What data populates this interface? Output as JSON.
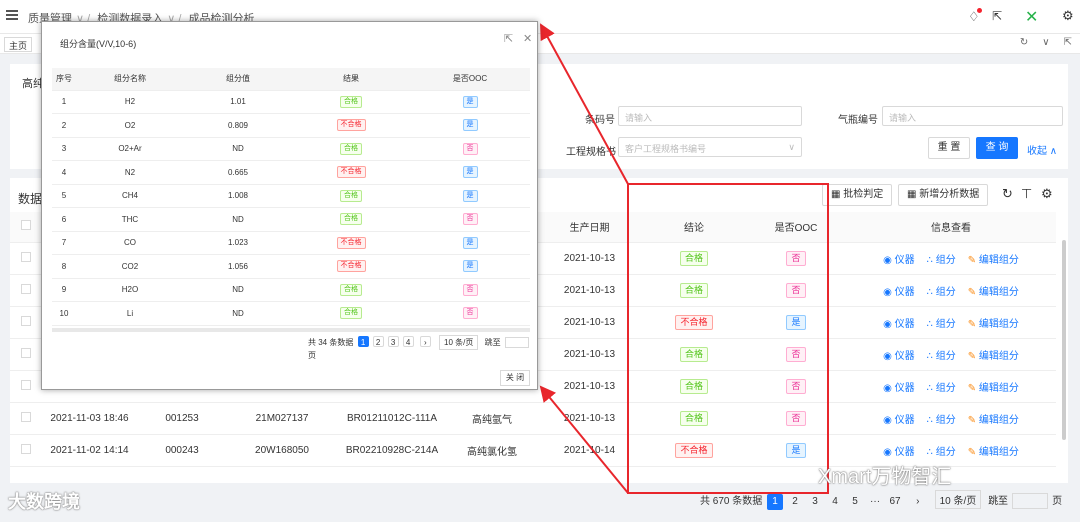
{
  "breadcrumb": [
    "质量管理",
    "检测数据录入",
    "成品检测分析"
  ],
  "tabs": {
    "home": "主页"
  },
  "filter": {
    "title_partial": "高纯",
    "barcode_label": "条码号",
    "barcode_placeholder": "请输入",
    "cylinder_label": "气瓶编号",
    "cylinder_placeholder": "请输入",
    "spec_label": "工程规格书",
    "spec_placeholder": "客户工程规格书编号",
    "reset": "重 置",
    "query": "查 询",
    "collapse": "收起"
  },
  "data_card": {
    "title_partial": "数据",
    "batch_judge": "批检判定",
    "add_analysis": "新增分析数据"
  },
  "main_table": {
    "headers": {
      "date": "生产日期",
      "result": "结论",
      "ooc": "是否OOC",
      "info": "信息查看"
    },
    "actions": {
      "instrument": "仪器",
      "component": "组分",
      "edit": "编辑组分"
    },
    "rows": [
      {
        "time": "",
        "code": "",
        "lot": "",
        "batch": "",
        "gas": "",
        "date": "2021-10-13",
        "result": "合格",
        "rt": "ok",
        "ooc": "否",
        "ot": "no"
      },
      {
        "time": "",
        "code": "",
        "lot": "",
        "batch": "",
        "gas": "",
        "date": "2021-10-13",
        "result": "合格",
        "rt": "ok",
        "ooc": "否",
        "ot": "no"
      },
      {
        "time": "",
        "code": "",
        "lot": "",
        "batch": "",
        "gas": "",
        "date": "2021-10-13",
        "result": "不合格",
        "rt": "ng",
        "ooc": "是",
        "ot": "yes"
      },
      {
        "time": "",
        "code": "",
        "lot": "",
        "batch": "",
        "gas": "",
        "date": "2021-10-13",
        "result": "合格",
        "rt": "ok",
        "ooc": "否",
        "ot": "no"
      },
      {
        "time": "",
        "code": "",
        "lot": "",
        "batch": "",
        "gas": "",
        "date": "2021-10-13",
        "result": "合格",
        "rt": "ok",
        "ooc": "否",
        "ot": "no"
      },
      {
        "time": "2021-11-03 18:46",
        "code": "001253",
        "lot": "21M027137",
        "batch": "BR01211012C-111A",
        "gas": "高纯氩气",
        "date": "2021-10-13",
        "result": "合格",
        "rt": "ok",
        "ooc": "否",
        "ot": "no"
      },
      {
        "time": "2021-11-02 14:14",
        "code": "000243",
        "lot": "20W168050",
        "batch": "BR02210928C-214A",
        "gas": "高纯氯化氢",
        "date": "2021-10-14",
        "result": "不合格",
        "rt": "ng",
        "ooc": "是",
        "ot": "yes"
      }
    ]
  },
  "pagination": {
    "total": "共 670 条数据",
    "pages": [
      "1",
      "2",
      "3",
      "4",
      "5",
      "···",
      "67"
    ],
    "size": "10 条/页",
    "jump": "跳至",
    "page": "页"
  },
  "modal": {
    "title": "组分含量(V/V,10-6)",
    "headers": [
      "序号",
      "组分名称",
      "组分值",
      "结果",
      "是否OOC"
    ],
    "rows": [
      [
        "1",
        "H2",
        "1.01",
        "合格",
        "ok",
        "是",
        "yes"
      ],
      [
        "2",
        "O2",
        "0.809",
        "不合格",
        "ng",
        "是",
        "yes"
      ],
      [
        "3",
        "O2+Ar",
        "ND",
        "合格",
        "ok",
        "否",
        "no"
      ],
      [
        "4",
        "N2",
        "0.665",
        "不合格",
        "ng",
        "是",
        "yes"
      ],
      [
        "5",
        "CH4",
        "1.008",
        "合格",
        "ok",
        "是",
        "yes"
      ],
      [
        "6",
        "THC",
        "ND",
        "合格",
        "ok",
        "否",
        "no"
      ],
      [
        "7",
        "CO",
        "1.023",
        "不合格",
        "ng",
        "是",
        "yes"
      ],
      [
        "8",
        "CO2",
        "1.056",
        "不合格",
        "ng",
        "是",
        "yes"
      ],
      [
        "9",
        "H2O",
        "ND",
        "合格",
        "ok",
        "否",
        "no"
      ],
      [
        "10",
        "Li",
        "ND",
        "合格",
        "ok",
        "否",
        "no"
      ]
    ],
    "pager": {
      "total": "共 34 条数据",
      "pages": [
        "1",
        "2",
        "3",
        "4"
      ],
      "size": "10 条/页",
      "jump": "跳至",
      "page": "页"
    },
    "close": "关 闭"
  },
  "watermarks": {
    "left": "大数跨境",
    "right": "Xmart万物智汇"
  },
  "colors": {
    "accent": "#1677ff",
    "highlight": "#e8262c",
    "brand": "#27b24a"
  }
}
